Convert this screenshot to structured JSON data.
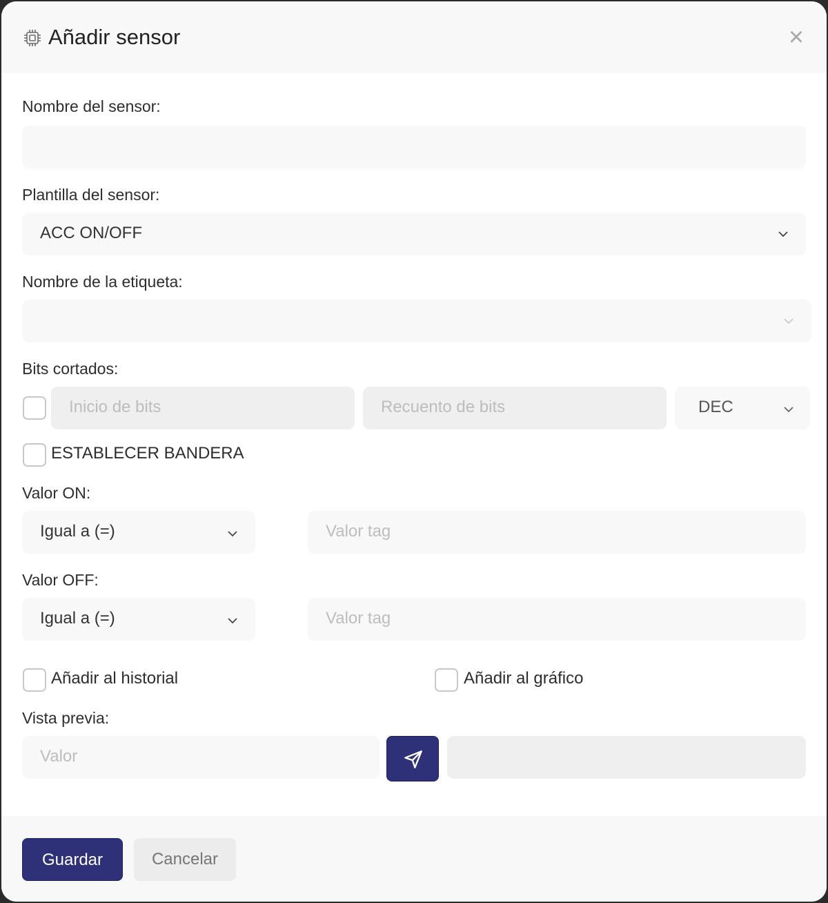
{
  "dialog": {
    "title": "Añadir sensor",
    "close_glyph": "×",
    "header_icon": "chip-icon"
  },
  "form": {
    "sensor_name": {
      "label": "Nombre del sensor:",
      "value": ""
    },
    "sensor_template": {
      "label": "Plantilla del sensor:",
      "selected": "ACC ON/OFF"
    },
    "tag_name": {
      "label": "Nombre de la etiqueta:",
      "selected": ""
    },
    "cut_bits": {
      "label": "Bits cortados:",
      "checked": false,
      "bit_start_placeholder": "Inicio de bits",
      "bit_count_placeholder": "Recuento de bits",
      "format_selected": "DEC"
    },
    "set_flag": {
      "label": "ESTABLECER BANDERA",
      "checked": false
    },
    "on_value": {
      "label": "Valor ON:",
      "operator_selected": "Igual a (=)",
      "value_placeholder": "Valor tag"
    },
    "off_value": {
      "label": "Valor OFF:",
      "operator_selected": "Igual a (=)",
      "value_placeholder": "Valor tag"
    },
    "add_to_history": {
      "label": "Añadir al historial",
      "checked": false
    },
    "add_to_chart": {
      "label": "Añadir al gráfico",
      "checked": false
    },
    "preview": {
      "label": "Vista previa:",
      "value_placeholder": "Valor",
      "send_icon": "paper-plane-icon",
      "result": ""
    }
  },
  "footer": {
    "save_label": "Guardar",
    "cancel_label": "Cancelar"
  },
  "colors": {
    "primary": "#2e3178",
    "field_bg": "#f8f8f8",
    "disabled_bg": "#efefef",
    "placeholder": "#bdbdbd"
  }
}
